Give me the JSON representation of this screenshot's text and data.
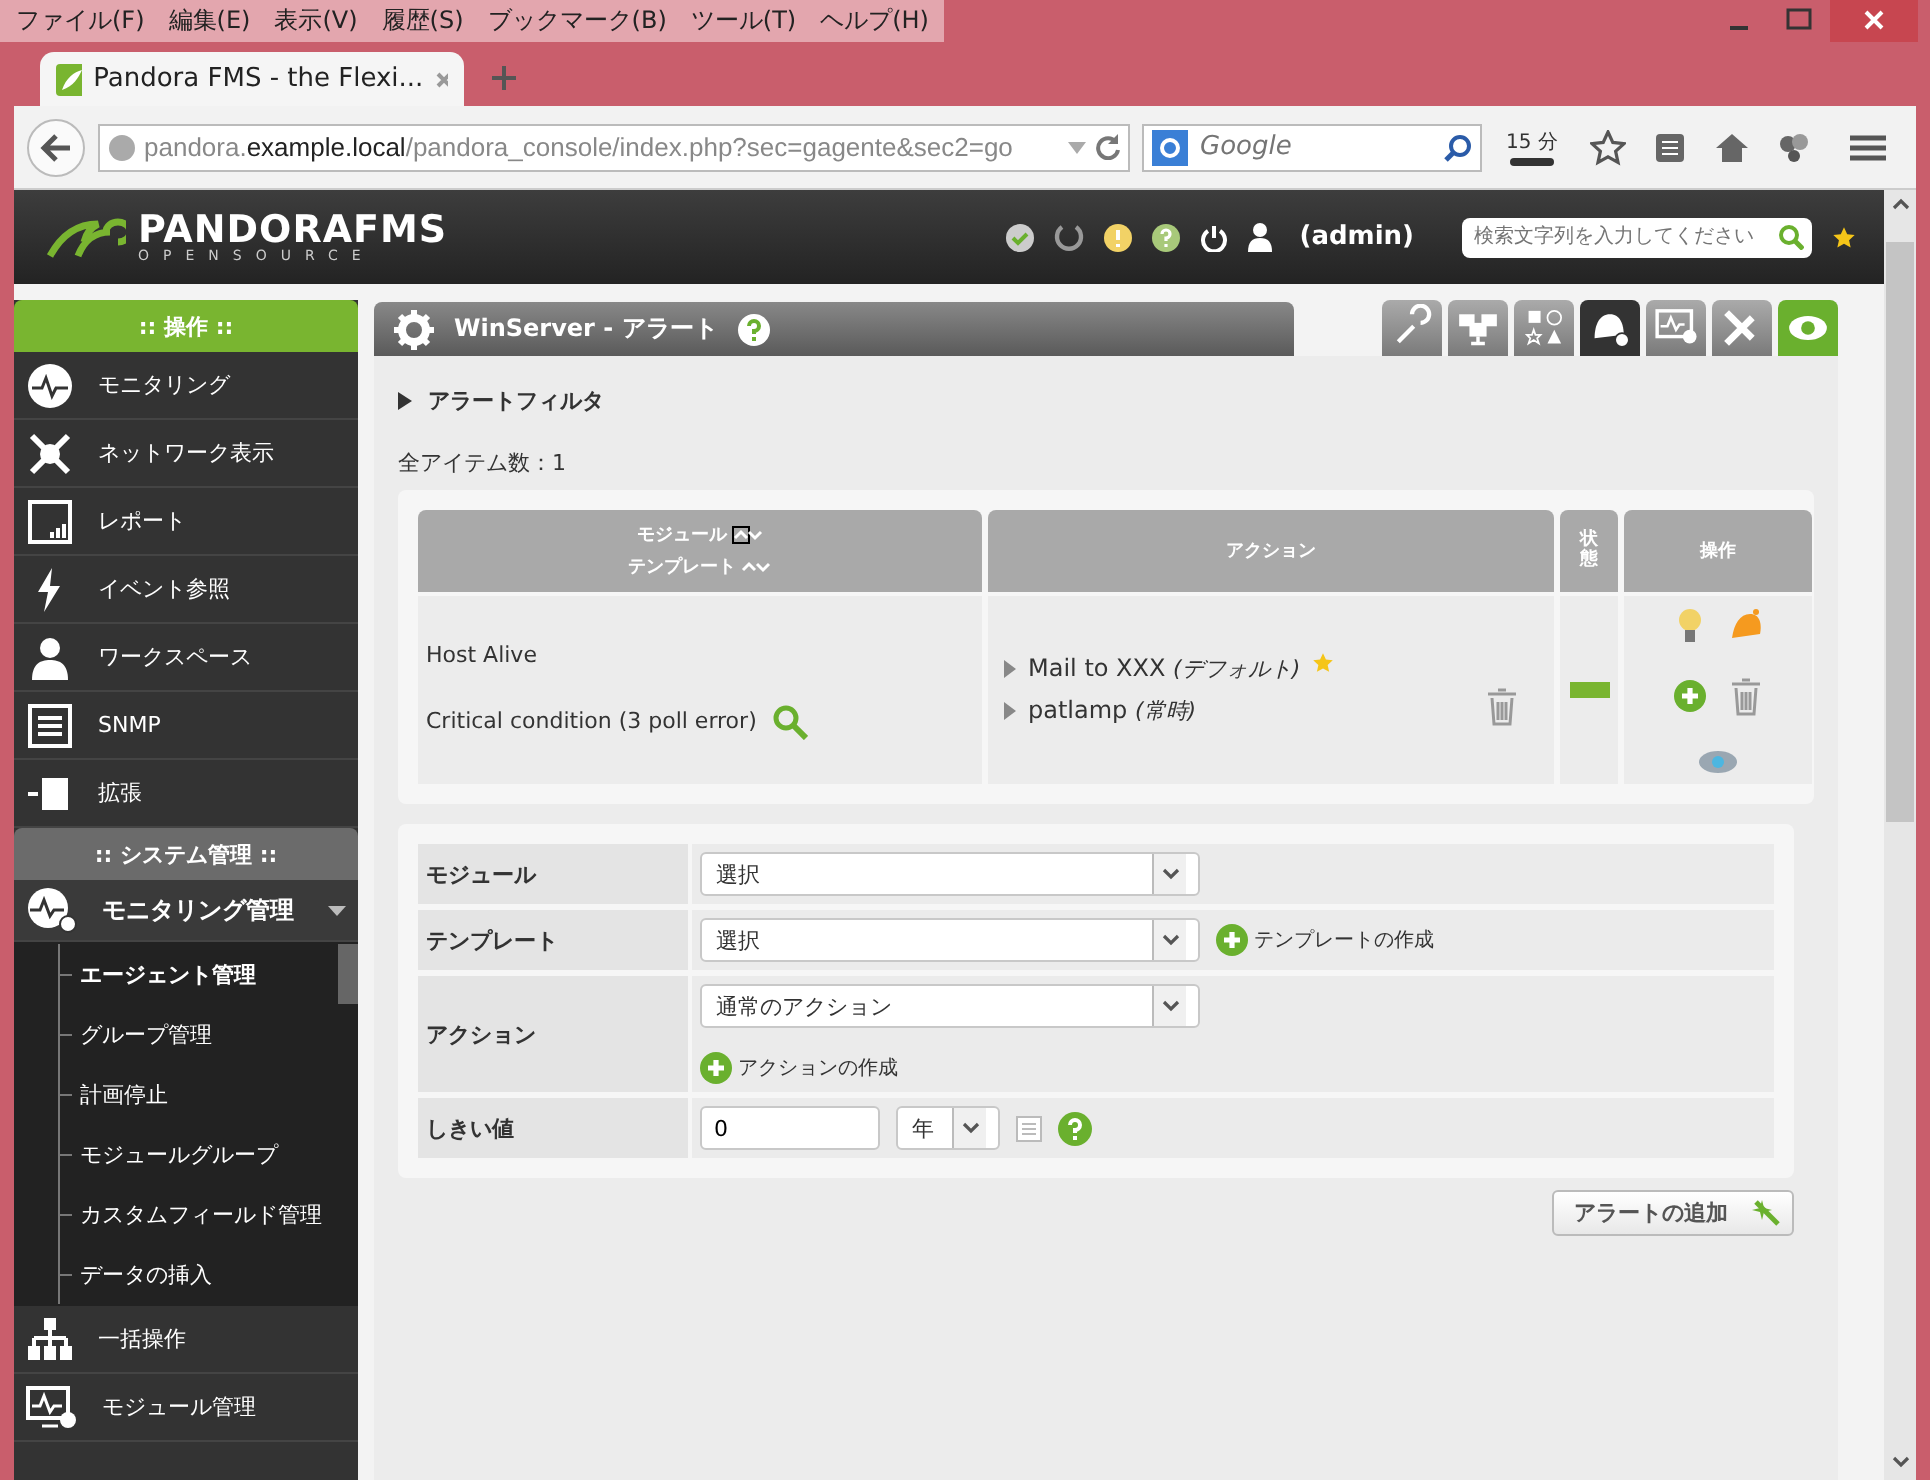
{
  "menu_bar": [
    "ファイル(F)",
    "編集(E)",
    "表示(V)",
    "履歴(S)",
    "ブックマーク(B)",
    "ツール(T)",
    "ヘルプ(H)"
  ],
  "browser_tab": {
    "title": "Pandora FMS - the Flexi..."
  },
  "address_bar": {
    "url": "pandora.**example.local**/pandora_console/index.php?sec=gagente&sec2=go"
  },
  "web_search": {
    "placeholder": "Google"
  },
  "timer_badge": "15 分",
  "header": {
    "logo_name": "PANDORAFMS",
    "logo_tagline": "OPENSOURCE",
    "user": "(admin)",
    "search_placeholder": "検索文字列を入力してください"
  },
  "sidebar": [
    {
      "title": ":: 操作 ::",
      "color": "#79b530",
      "items": [
        {
          "label": "モニタリング",
          "expanded": false
        },
        {
          "label": "ネットワーク表示",
          "expanded": false
        },
        {
          "label": "レポート",
          "expanded": false
        },
        {
          "label": "イベント参照",
          "expanded": false
        },
        {
          "label": "ワークスペース",
          "expanded": false
        },
        {
          "label": "SNMP",
          "expanded": false
        },
        {
          "label": "拡張",
          "expanded": false
        }
      ]
    },
    {
      "title": ":: システム管理 ::",
      "color": "#6b6b6b",
      "items": [
        {
          "label": "モニタリング管理",
          "expanded": true,
          "children": [
            {
              "label": "エージェント管理",
              "selected": true
            },
            {
              "label": "グループ管理",
              "selected": false
            },
            {
              "label": "計画停止",
              "selected": false
            },
            {
              "label": "モジュールグループ",
              "selected": false
            },
            {
              "label": "カスタムフィールド管理",
              "selected": false
            },
            {
              "label": "データの挿入",
              "selected": false
            }
          ]
        },
        {
          "label": "一括操作",
          "expanded": false
        },
        {
          "label": "モジュール管理",
          "expanded": false
        }
      ]
    }
  ],
  "page_title": "WinServer - アラート",
  "toolbar_tabs": [
    {
      "kind": "normal",
      "selected": false
    },
    {
      "kind": "normal",
      "selected": false
    },
    {
      "kind": "normal",
      "selected": false
    },
    {
      "kind": "normal",
      "selected": true
    },
    {
      "kind": "normal",
      "selected": false
    },
    {
      "kind": "normal",
      "selected": false
    },
    {
      "kind": "view",
      "selected": false
    }
  ],
  "filter_label": "アラートフィルタ",
  "item_count": "全アイテム数：1",
  "table": {
    "columns": [
      {
        "labels": [
          {
            "text": "モジュール",
            "sort_up": true
          },
          {
            "text": "テンプレート",
            "sort_up": false
          }
        ]
      },
      {
        "labels": [
          {
            "text": "アクション"
          }
        ]
      },
      {
        "labels": [
          {
            "text": "状態"
          }
        ]
      },
      {
        "labels": [
          {
            "text": "操作"
          }
        ]
      }
    ],
    "rows": [
      {
        "module": "Host Alive",
        "template": "Critical condition (3 poll error)",
        "actions": [
          {
            "name": "Mail to XXX",
            "mode": "(デフォルト)",
            "starred": true
          },
          {
            "name": "patlamp",
            "mode": "(常時)",
            "starred": false
          }
        ],
        "color": "#79b530"
      }
    ]
  },
  "form": [
    {
      "label": "モジュール",
      "select": "選択"
    },
    {
      "label": "テンプレート",
      "select": "選択",
      "link": "テンプレートの作成"
    },
    {
      "label": "アクション",
      "select": "通常のアクション",
      "link": "アクションの作成"
    },
    {
      "label": "しきい値",
      "input": "0",
      "unit": "年"
    }
  ],
  "add_button": "アラートの追加"
}
